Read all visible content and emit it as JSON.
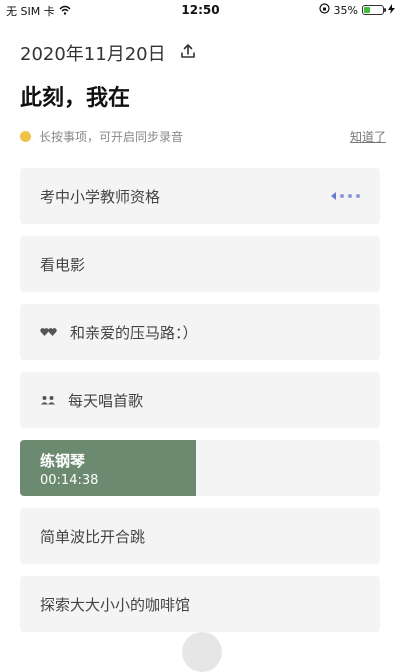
{
  "status_bar": {
    "carrier": "无 SIM 卡",
    "time": "12:50",
    "battery_percent": "35%",
    "battery_level": 0.35
  },
  "header": {
    "date": "2020年11月20日",
    "title": "此刻，我在"
  },
  "hint": {
    "text": "长按事项，可开启同步录音",
    "link": "知道了"
  },
  "tasks": [
    {
      "label": "考中小学教师资格",
      "icon": "voice-dots-icon"
    },
    {
      "label": "看电影"
    },
    {
      "label": "和亲爱的压马路：）",
      "icon": "hearts-icon"
    },
    {
      "label": "每天唱首歌",
      "icon": "people-icon"
    },
    {
      "label": "练钢琴",
      "timer": "00:14:38",
      "progress": 0.49,
      "color": "#6b8a70"
    },
    {
      "label": "简单波比开合跳"
    },
    {
      "label": "探索大大小小的咖啡馆"
    }
  ]
}
